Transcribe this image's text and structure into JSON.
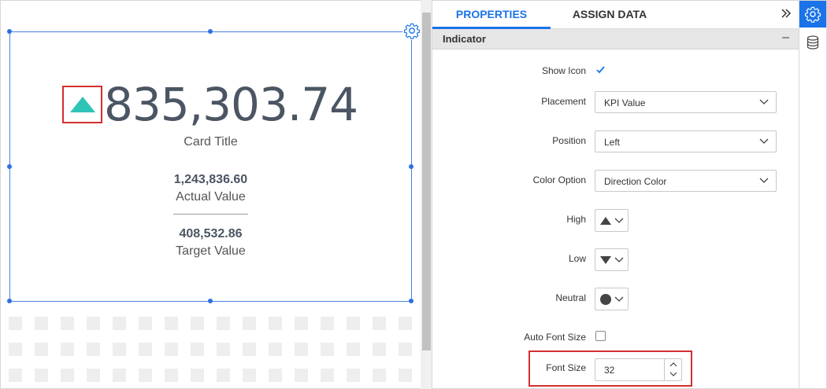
{
  "kpi_card": {
    "value": "835,303.74",
    "title": "Card Title",
    "actual_value": "1,243,836.60",
    "actual_label": "Actual Value",
    "target_value": "408,532.86",
    "target_label": "Target Value",
    "indicator_icon": "triangle-up-icon",
    "indicator_color": "#2ec4b6",
    "value_color": "#4b5563"
  },
  "tabs": [
    {
      "label": "PROPERTIES",
      "active": true
    },
    {
      "label": "ASSIGN DATA",
      "active": false
    }
  ],
  "section": {
    "title": "Indicator"
  },
  "fields": {
    "show_icon": {
      "label": "Show Icon",
      "checked": true
    },
    "placement": {
      "label": "Placement",
      "value": "KPI Value"
    },
    "position": {
      "label": "Position",
      "value": "Left"
    },
    "color_option": {
      "label": "Color Option",
      "value": "Direction Color"
    },
    "high": {
      "label": "High",
      "icon": "triangle-up-icon"
    },
    "low": {
      "label": "Low",
      "icon": "triangle-down-icon"
    },
    "neutral": {
      "label": "Neutral",
      "icon": "circle-icon"
    },
    "auto_font_size": {
      "label": "Auto Font Size",
      "checked": false
    },
    "font_size": {
      "label": "Font Size",
      "value": "32"
    }
  },
  "colors": {
    "accent": "#1a73e8",
    "highlight_box": "#d32f2f"
  }
}
